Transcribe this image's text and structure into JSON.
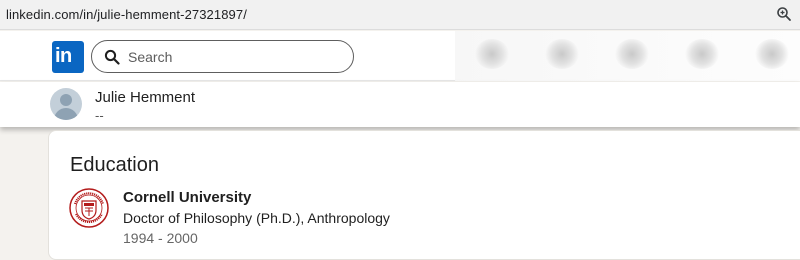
{
  "browser": {
    "url": "linkedin.com/in/julie-hemment-27321897/",
    "zoom_icon": "zoom-icon"
  },
  "nav": {
    "logo_text": "in",
    "search_placeholder": "Search",
    "icons": [
      "linkedin-logo-icon",
      "search-icon"
    ],
    "brand_color": "#0a66c2"
  },
  "profile": {
    "name": "Julie Hemment",
    "headline": "--",
    "avatar_icon": "default-avatar-icon"
  },
  "education": {
    "title": "Education",
    "entries": [
      {
        "school": "Cornell University",
        "degree": "Doctor of Philosophy (Ph.D.), Anthropology",
        "dates": "1994 - 2000",
        "logo_icon": "cornell-seal-icon",
        "logo_text": "CORNELL UNIVERSITY · FOUNDED A.D. 1865"
      }
    ]
  }
}
